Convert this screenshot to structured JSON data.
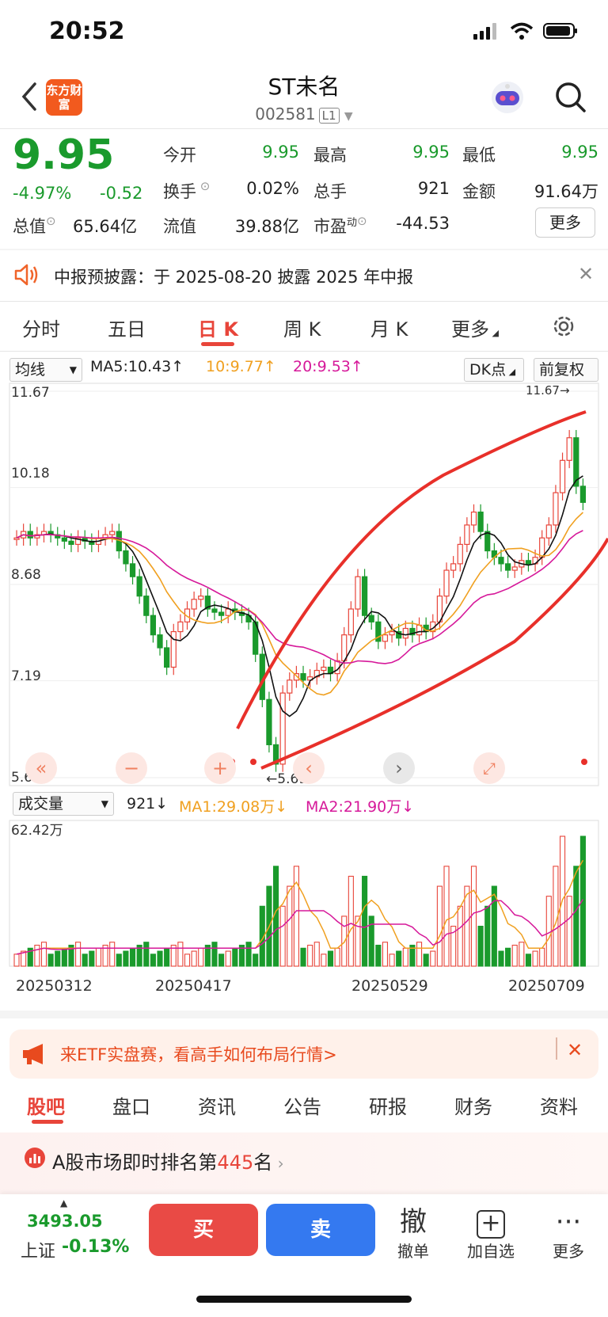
{
  "status": {
    "time": "20:52"
  },
  "header": {
    "logo": "东方财富",
    "name": "ST未名",
    "code": "002581",
    "level": "L1"
  },
  "quote": {
    "price": "9.95",
    "change_pct": "-4.97%",
    "change": "-0.52",
    "open_label": "今开",
    "open": "9.95",
    "high_label": "最高",
    "high": "9.95",
    "low_label": "最低",
    "low": "9.95",
    "turnover_label": "换手",
    "turnover": "0.02%",
    "volume_label": "总手",
    "volume": "921",
    "amount_label": "金额",
    "amount": "91.64万",
    "mktcap_label": "总值",
    "mktcap": "65.64亿",
    "float_label": "流值",
    "float": "39.88亿",
    "pe_label": "市盈",
    "pe_sup": "动",
    "pe": "-44.53",
    "more": "更多"
  },
  "notice": {
    "text": "中报预披露：于 2025-08-20 披露 2025 年中报"
  },
  "ktabs": [
    "分时",
    "五日",
    "日 K",
    "周 K",
    "月 K",
    "更多"
  ],
  "ma": {
    "select": "均线",
    "ma5": "MA5:10.43",
    "ma10": "10:9.77",
    "ma20": "20:9.53",
    "dk": "DK点",
    "adjust": "前复权"
  },
  "price_axis": [
    "11.67",
    "10.18",
    "8.68",
    "7.19",
    "5.69"
  ],
  "price_marks": {
    "high": "11.67",
    "low": "5.69"
  },
  "volume": {
    "select": "成交量",
    "value": "921",
    "ma1": "MA1:29.08万",
    "ma2": "MA2:21.90万",
    "axis_max": "62.42万"
  },
  "dates": [
    "20250312",
    "20250417",
    "20250529",
    "20250709"
  ],
  "etf": {
    "text": "来ETF实盘赛，看高手如何布局行情>"
  },
  "btabs": [
    "股吧",
    "盘口",
    "资讯",
    "公告",
    "研报",
    "财务",
    "资料"
  ],
  "rank": {
    "prefix": "A股市场即时排名第",
    "num": "445",
    "suffix": "名"
  },
  "bottom": {
    "index_value": "3493.05",
    "index_name": "上证",
    "index_change": "-0.13%",
    "buy": "买",
    "sell": "卖",
    "cancel_glyph": "撤",
    "cancel": "撤单",
    "add": "加自选",
    "more": "更多"
  },
  "colors": {
    "up": "#e8453a",
    "down": "#1a9a2c",
    "accent": "#e8453a",
    "buy": "#e94a45",
    "sell": "#3479f0"
  },
  "chart_data": {
    "type": "candlestick",
    "y_axis": [
      11.67,
      10.18,
      8.68,
      7.19,
      5.69
    ],
    "ylim": [
      5.69,
      11.67
    ],
    "x_ticks": [
      "20250312",
      "20250417",
      "20250529",
      "20250709"
    ],
    "volume_max": "62.42万",
    "closes": [
      9.4,
      9.5,
      9.4,
      9.45,
      9.5,
      9.45,
      9.4,
      9.35,
      9.3,
      9.4,
      9.35,
      9.3,
      9.4,
      9.45,
      9.5,
      9.2,
      9.0,
      8.8,
      8.5,
      8.2,
      7.9,
      7.7,
      7.4,
      7.95,
      8.1,
      8.3,
      8.45,
      8.5,
      8.3,
      8.25,
      8.2,
      8.3,
      8.25,
      8.2,
      8.1,
      7.6,
      6.9,
      6.2,
      5.9,
      7.0,
      7.2,
      7.3,
      7.2,
      7.25,
      7.35,
      7.4,
      7.3,
      7.5,
      7.9,
      8.3,
      8.8,
      8.2,
      8.1,
      7.8,
      7.9,
      7.95,
      7.85,
      8.0,
      7.9,
      8.05,
      7.95,
      8.1,
      8.5,
      8.9,
      9.0,
      9.3,
      9.6,
      9.8,
      9.5,
      9.2,
      9.1,
      9.0,
      8.9,
      8.95,
      9.05,
      9.0,
      9.1,
      9.4,
      9.6,
      10.1,
      10.6,
      10.95,
      10.2,
      9.95
    ]
  }
}
